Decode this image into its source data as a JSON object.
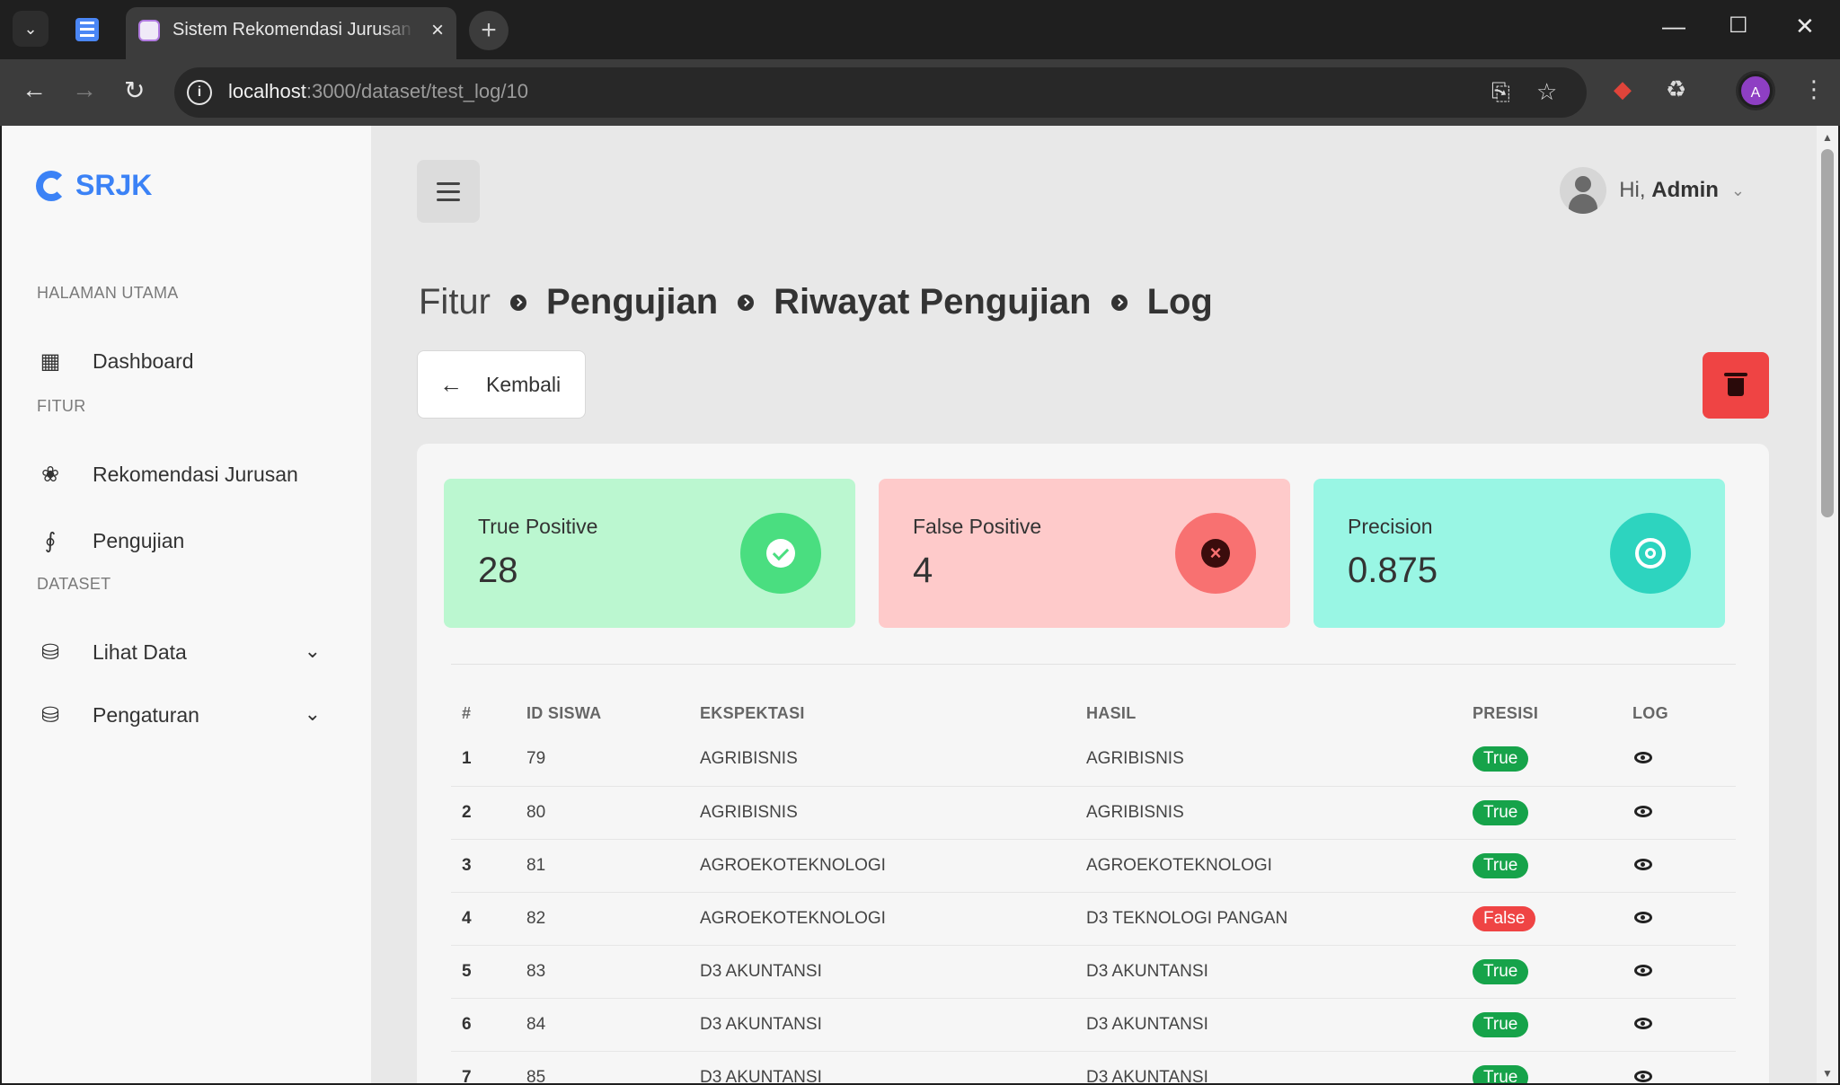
{
  "browser": {
    "tab_title": "Sistem Rekomendasi Jurusan Kuliah",
    "url_host": "localhost",
    "url_path": ":3000/dataset/test_log/10",
    "profile_initial": "A"
  },
  "sidebar": {
    "logo": "SRJK",
    "sections": [
      {
        "title": "HALAMAN UTAMA",
        "items": [
          {
            "label": "Dashboard",
            "icon": "grid-icon"
          }
        ]
      },
      {
        "title": "FITUR",
        "items": [
          {
            "label": "Rekomendasi Jurusan",
            "icon": "atom-icon"
          },
          {
            "label": "Pengujian",
            "icon": "nodes-icon"
          }
        ]
      },
      {
        "title": "DATASET",
        "items": [
          {
            "label": "Lihat Data",
            "icon": "database-icon"
          },
          {
            "label": "Pengaturan",
            "icon": "database-settings-icon"
          }
        ]
      }
    ]
  },
  "header": {
    "greeting": "Hi,",
    "username": "Admin"
  },
  "breadcrumb": [
    "Fitur",
    "Pengujian",
    "Riwayat Pengujian",
    "Log"
  ],
  "actions": {
    "back_label": "Kembali"
  },
  "stats": [
    {
      "label": "True Positive",
      "value": "28",
      "color": "#bbf7d0",
      "accent": "#4ade80"
    },
    {
      "label": "False Positive",
      "value": "4",
      "color": "#fecaca",
      "accent": "#f87171"
    },
    {
      "label": "Precision",
      "value": "0.875",
      "color": "#99f6e4",
      "accent": "#2dd4bf"
    }
  ],
  "table": {
    "headers": [
      "#",
      "ID SISWA",
      "EKSPEKTASI",
      "HASIL",
      "PRESISI",
      "LOG"
    ],
    "rows": [
      {
        "no": "1",
        "id": "79",
        "ekspektasi": "AGRIBISNIS",
        "hasil": "AGRIBISNIS",
        "presisi": "True"
      },
      {
        "no": "2",
        "id": "80",
        "ekspektasi": "AGRIBISNIS",
        "hasil": "AGRIBISNIS",
        "presisi": "True"
      },
      {
        "no": "3",
        "id": "81",
        "ekspektasi": "AGROEKOTEKNOLOGI",
        "hasil": "AGROEKOTEKNOLOGI",
        "presisi": "True"
      },
      {
        "no": "4",
        "id": "82",
        "ekspektasi": "AGROEKOTEKNOLOGI",
        "hasil": "D3 TEKNOLOGI PANGAN",
        "presisi": "False"
      },
      {
        "no": "5",
        "id": "83",
        "ekspektasi": "D3 AKUNTANSI",
        "hasil": "D3 AKUNTANSI",
        "presisi": "True"
      },
      {
        "no": "6",
        "id": "84",
        "ekspektasi": "D3 AKUNTANSI",
        "hasil": "D3 AKUNTANSI",
        "presisi": "True"
      },
      {
        "no": "7",
        "id": "85",
        "ekspektasi": "D3 AKUNTANSI",
        "hasil": "D3 AKUNTANSI",
        "presisi": "True"
      }
    ]
  }
}
